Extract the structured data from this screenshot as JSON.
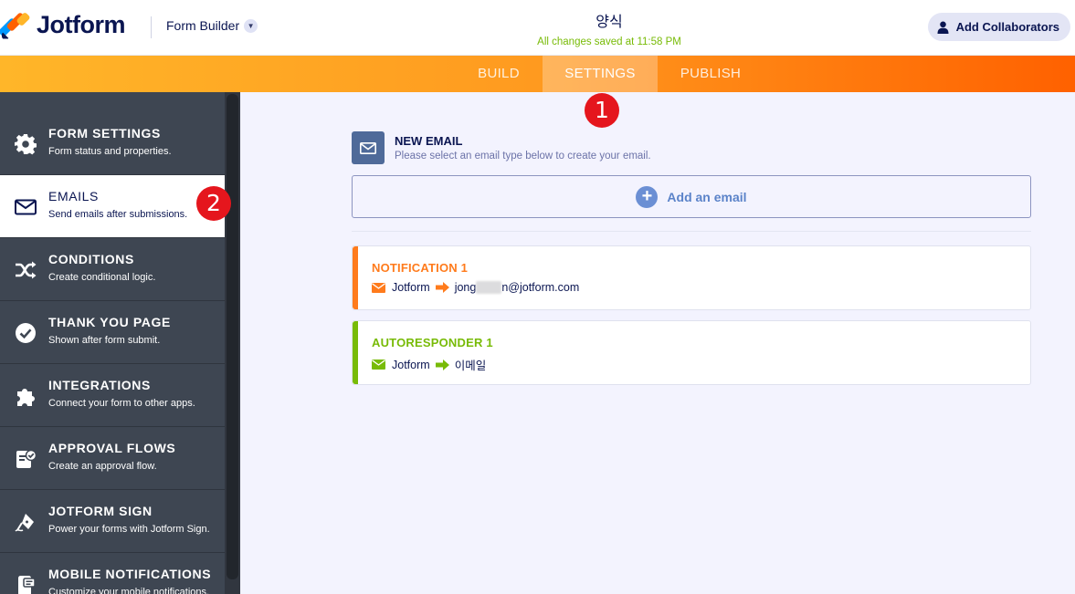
{
  "header": {
    "brand": "Jotform",
    "form_builder_label": "Form Builder",
    "form_title": "양식",
    "save_status": "All changes saved at 11:58 PM",
    "collaborators_button": "Add Collaborators"
  },
  "nav": {
    "tabs": [
      {
        "label": "BUILD"
      },
      {
        "label": "SETTINGS",
        "active": true
      },
      {
        "label": "PUBLISH"
      }
    ]
  },
  "sidebar": {
    "items": [
      {
        "title": "FORM SETTINGS",
        "desc": "Form status and properties.",
        "icon": "gear-icon"
      },
      {
        "title": "EMAILS",
        "desc": "Send emails after submissions.",
        "icon": "envelope-icon",
        "active": true
      },
      {
        "title": "CONDITIONS",
        "desc": "Create conditional logic.",
        "icon": "shuffle-icon"
      },
      {
        "title": "THANK YOU PAGE",
        "desc": "Shown after form submit.",
        "icon": "check-circle-icon"
      },
      {
        "title": "INTEGRATIONS",
        "desc": "Connect your form to other apps.",
        "icon": "puzzle-icon"
      },
      {
        "title": "APPROVAL FLOWS",
        "desc": "Create an approval flow.",
        "icon": "approval-icon"
      },
      {
        "title": "JOTFORM SIGN",
        "desc": "Power your forms with Jotform Sign.",
        "icon": "pen-icon"
      },
      {
        "title": "MOBILE NOTIFICATIONS",
        "desc": "Customize your mobile notifications.",
        "icon": "mobile-icon"
      }
    ]
  },
  "markers": {
    "one": "1",
    "two": "2"
  },
  "main": {
    "new_email": {
      "title": "NEW EMAIL",
      "subtitle": "Please select an email type below to create your email."
    },
    "add_email_label": "Add an email",
    "emails": [
      {
        "title": "NOTIFICATION 1",
        "from": "Jotform",
        "to_prefix": "jong",
        "to_suffix": "n@jotform.com",
        "color": "#ff7b1c"
      },
      {
        "title": "AUTORESPONDER 1",
        "from": "Jotform",
        "to": "이메일",
        "color": "#78bb07"
      }
    ]
  }
}
